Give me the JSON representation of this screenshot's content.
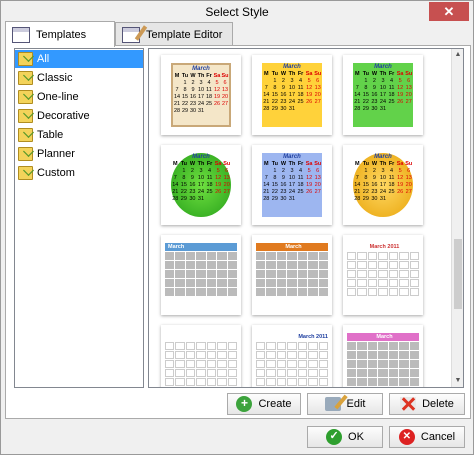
{
  "window": {
    "title": "Select Style",
    "close_label": "✕"
  },
  "tabs": [
    {
      "label": "Templates",
      "icon": "calendar-icon",
      "active": true
    },
    {
      "label": "Template Editor",
      "icon": "calendar-edit-icon",
      "active": false
    }
  ],
  "categories": [
    {
      "label": "All",
      "selected": true
    },
    {
      "label": "Classic"
    },
    {
      "label": "One-line"
    },
    {
      "label": "Decorative"
    },
    {
      "label": "Table"
    },
    {
      "label": "Planner"
    },
    {
      "label": "Custom"
    }
  ],
  "calendar": {
    "month": "March",
    "month_year": "March 2011",
    "weekdays": [
      "M",
      "Tu",
      "W",
      "Th",
      "Fr",
      "Sa",
      "Su"
    ],
    "days": [
      [
        "",
        "1",
        "2",
        "3",
        "4",
        "5",
        "6"
      ],
      [
        "7",
        "8",
        "9",
        "10",
        "11",
        "12",
        "13"
      ],
      [
        "14",
        "15",
        "16",
        "17",
        "18",
        "19",
        "20"
      ],
      [
        "21",
        "22",
        "23",
        "24",
        "25",
        "26",
        "27"
      ],
      [
        "28",
        "29",
        "30",
        "31",
        "",
        "",
        ""
      ]
    ]
  },
  "actions": {
    "create": "Create",
    "edit": "Edit",
    "delete": "Delete"
  },
  "dialog": {
    "ok": "OK",
    "cancel": "Cancel"
  },
  "colors": {
    "selection": "#3399ff",
    "close": "#c75050"
  }
}
